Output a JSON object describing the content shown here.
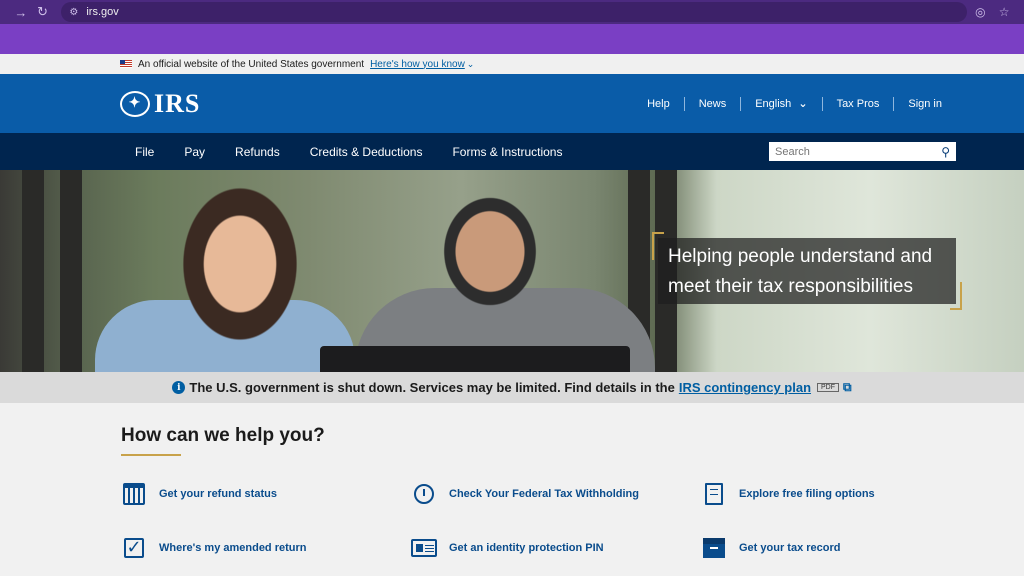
{
  "browser": {
    "url": "irs.gov",
    "back_icon": "arrow-right-icon",
    "reload_icon": "reload-icon"
  },
  "gov_banner": {
    "text": "An official website of the United States government",
    "link": "Here's how you know"
  },
  "header": {
    "logo": "IRS",
    "util_nav": [
      "Help",
      "News",
      "English",
      "Tax Pros",
      "Sign in"
    ]
  },
  "main_nav": {
    "links": [
      "File",
      "Pay",
      "Refunds",
      "Credits & Deductions",
      "Forms & Instructions"
    ],
    "search_placeholder": "Search"
  },
  "hero": {
    "callout": "Helping people understand and meet their tax responsibilities"
  },
  "alert": {
    "text": "The U.S. government is shut down. Services may be limited. Find details in the",
    "link": "IRS contingency plan",
    "badge": "PDF"
  },
  "help": {
    "title": "How can we help you?",
    "tasks": [
      {
        "label": "Get your refund status",
        "icon": "calendar-icon"
      },
      {
        "label": "Check Your Federal Tax Withholding",
        "icon": "clock-icon"
      },
      {
        "label": "Explore free filing options",
        "icon": "document-icon"
      },
      {
        "label": "Where's my amended return",
        "icon": "checkbox-icon"
      },
      {
        "label": "Get an identity protection PIN",
        "icon": "id-card-icon"
      },
      {
        "label": "Get your tax record",
        "icon": "archive-box-icon"
      }
    ]
  },
  "colors": {
    "header_blue": "#0a5ca8",
    "nav_navy": "#00254f",
    "link_blue": "#005ea2",
    "accent_gold": "#c8a24a"
  }
}
